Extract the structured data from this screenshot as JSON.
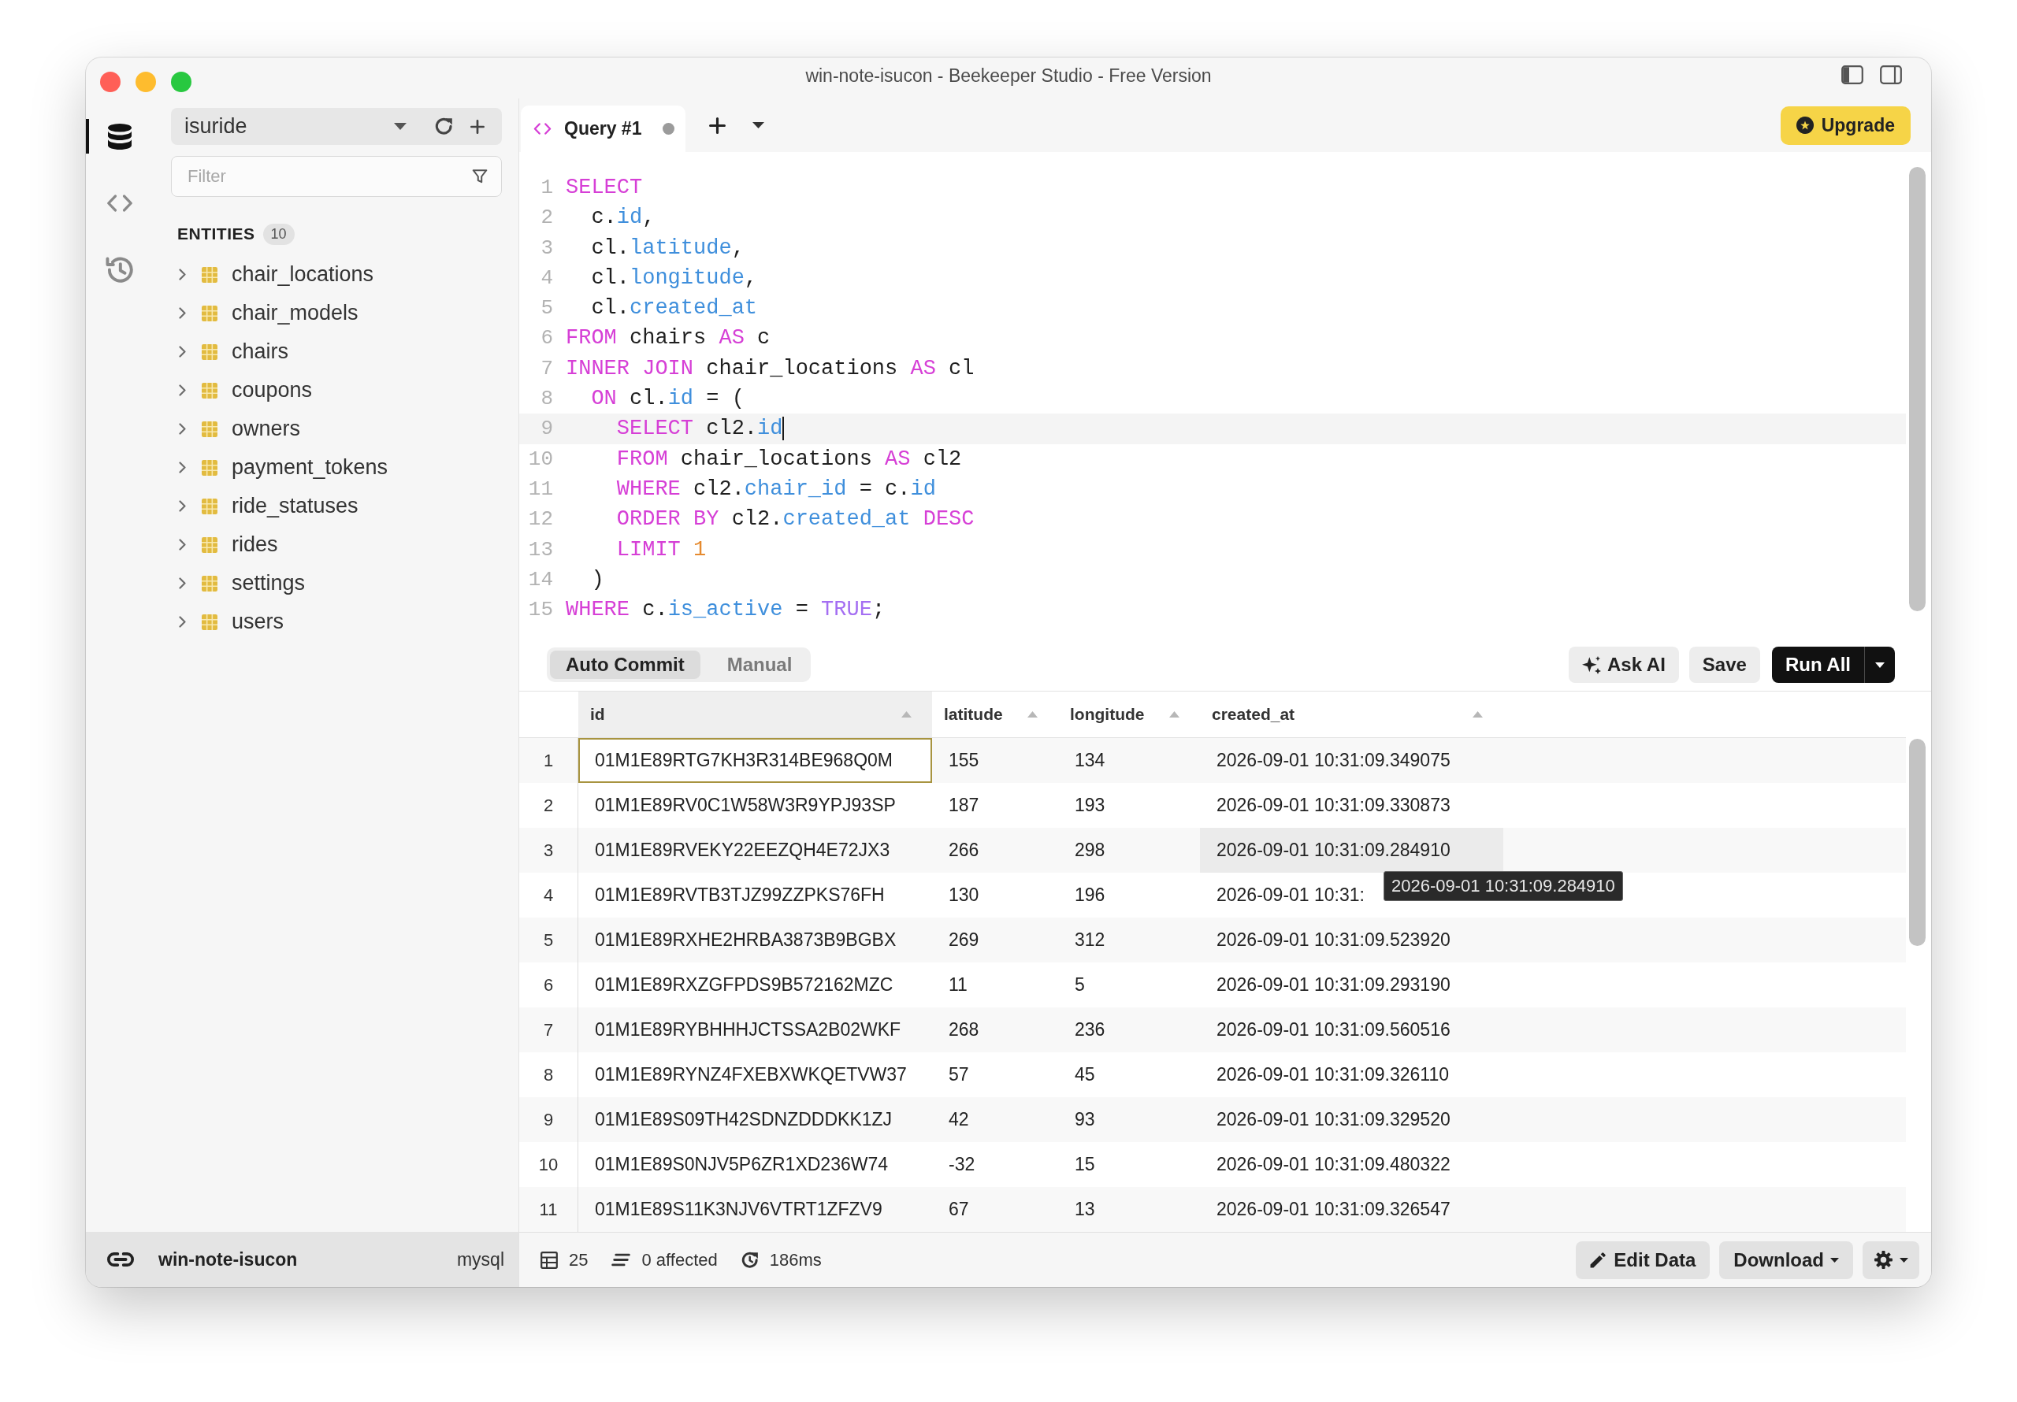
{
  "window": {
    "title": "win-note-isucon - Beekeeper Studio - Free Version"
  },
  "activity_bar": {
    "items": [
      {
        "kind": "connection",
        "selected": true
      },
      {
        "kind": "queries",
        "selected": false
      },
      {
        "kind": "history",
        "selected": false
      }
    ]
  },
  "sidebar": {
    "database": "isuride",
    "filter": {
      "placeholder": "Filter"
    },
    "entities": {
      "title": "ENTITIES",
      "count": "10",
      "items": [
        {
          "label": "chair_locations",
          "expanded": false
        },
        {
          "label": "chair_models",
          "expanded": false
        },
        {
          "label": "chairs",
          "expanded": false
        },
        {
          "label": "coupons",
          "expanded": false
        },
        {
          "label": "owners",
          "expanded": false
        },
        {
          "label": "payment_tokens",
          "expanded": false
        },
        {
          "label": "ride_statuses",
          "expanded": false
        },
        {
          "label": "rides",
          "expanded": false
        },
        {
          "label": "settings",
          "expanded": false
        },
        {
          "label": "users",
          "expanded": false
        }
      ]
    },
    "connection": {
      "name": "win-note-isucon",
      "driver": "mysql"
    }
  },
  "tabs": [
    {
      "label": "Query #1",
      "selected": true,
      "unsaved": true
    }
  ],
  "upgrade_button": {
    "label": "Upgrade"
  },
  "editor": {
    "lines": [
      {
        "number": "1",
        "active": false,
        "tokens": [
          {
            "kind": "keyword",
            "text": "SELECT"
          }
        ]
      },
      {
        "number": "2",
        "active": false,
        "tokens": [
          {
            "kind": "plain",
            "text": "  c."
          },
          {
            "kind": "field",
            "text": "id"
          },
          {
            "kind": "plain",
            "text": ","
          }
        ]
      },
      {
        "number": "3",
        "active": false,
        "tokens": [
          {
            "kind": "plain",
            "text": "  cl."
          },
          {
            "kind": "field",
            "text": "latitude"
          },
          {
            "kind": "plain",
            "text": ","
          }
        ]
      },
      {
        "number": "4",
        "active": false,
        "tokens": [
          {
            "kind": "plain",
            "text": "  cl."
          },
          {
            "kind": "field",
            "text": "longitude"
          },
          {
            "kind": "plain",
            "text": ","
          }
        ]
      },
      {
        "number": "5",
        "active": false,
        "tokens": [
          {
            "kind": "plain",
            "text": "  cl."
          },
          {
            "kind": "field",
            "text": "created_at"
          }
        ]
      },
      {
        "number": "6",
        "active": false,
        "tokens": [
          {
            "kind": "keyword",
            "text": "FROM"
          },
          {
            "kind": "plain",
            "text": " chairs "
          },
          {
            "kind": "keyword",
            "text": "AS"
          },
          {
            "kind": "plain",
            "text": " c"
          }
        ]
      },
      {
        "number": "7",
        "active": false,
        "tokens": [
          {
            "kind": "keyword",
            "text": "INNER JOIN"
          },
          {
            "kind": "plain",
            "text": " chair_locations "
          },
          {
            "kind": "keyword",
            "text": "AS"
          },
          {
            "kind": "plain",
            "text": " cl"
          }
        ]
      },
      {
        "number": "8",
        "active": false,
        "tokens": [
          {
            "kind": "keyword",
            "text": "  ON"
          },
          {
            "kind": "plain",
            "text": " cl."
          },
          {
            "kind": "field",
            "text": "id"
          },
          {
            "kind": "plain",
            "text": " = ("
          }
        ]
      },
      {
        "number": "9",
        "active": true,
        "tokens": [
          {
            "kind": "keyword",
            "text": "    SELECT"
          },
          {
            "kind": "plain",
            "text": " cl2."
          },
          {
            "kind": "field",
            "text": "id"
          }
        ]
      },
      {
        "number": "10",
        "active": false,
        "tokens": [
          {
            "kind": "keyword",
            "text": "    FROM"
          },
          {
            "kind": "plain",
            "text": " chair_locations "
          },
          {
            "kind": "keyword",
            "text": "AS"
          },
          {
            "kind": "plain",
            "text": " cl2"
          }
        ]
      },
      {
        "number": "11",
        "active": false,
        "tokens": [
          {
            "kind": "keyword",
            "text": "    WHERE"
          },
          {
            "kind": "plain",
            "text": " cl2."
          },
          {
            "kind": "field",
            "text": "chair_id"
          },
          {
            "kind": "plain",
            "text": " = c."
          },
          {
            "kind": "field",
            "text": "id"
          }
        ]
      },
      {
        "number": "12",
        "active": false,
        "tokens": [
          {
            "kind": "keyword",
            "text": "    ORDER BY"
          },
          {
            "kind": "plain",
            "text": " cl2."
          },
          {
            "kind": "field",
            "text": "created_at"
          },
          {
            "kind": "keyword",
            "text": " DESC"
          }
        ]
      },
      {
        "number": "13",
        "active": false,
        "tokens": [
          {
            "kind": "keyword",
            "text": "    LIMIT"
          },
          {
            "kind": "number",
            "text": " 1"
          }
        ]
      },
      {
        "number": "14",
        "active": false,
        "tokens": [
          {
            "kind": "plain",
            "text": "  )"
          }
        ]
      },
      {
        "number": "15",
        "active": false,
        "tokens": [
          {
            "kind": "keyword",
            "text": "WHERE"
          },
          {
            "kind": "plain",
            "text": " c."
          },
          {
            "kind": "field",
            "text": "is_active"
          },
          {
            "kind": "plain",
            "text": " = "
          },
          {
            "kind": "literal",
            "text": "TRUE"
          },
          {
            "kind": "plain",
            "text": ";"
          }
        ]
      }
    ]
  },
  "commit_mode": [
    {
      "label": "Auto Commit",
      "selected": true
    },
    {
      "label": "Manual",
      "selected": false
    }
  ],
  "actions": [
    {
      "kind": "ai",
      "label": "Ask AI"
    },
    {
      "kind": "save",
      "label": "Save"
    },
    {
      "kind": "run",
      "label": "Run All"
    }
  ],
  "results": {
    "columns": [
      {
        "label": "id",
        "selected": true
      },
      {
        "label": "latitude",
        "selected": false
      },
      {
        "label": "longitude",
        "selected": false
      },
      {
        "label": "created_at",
        "selected": false
      }
    ],
    "rows": [
      {
        "number": "1",
        "cells": [
          {
            "text": "01M1E89RTG7KH3R314BE968Q0M",
            "selected": true,
            "hovered": false
          },
          {
            "text": "155",
            "selected": false,
            "hovered": false
          },
          {
            "text": "134",
            "selected": false,
            "hovered": false
          },
          {
            "text": "2026-09-01 10:31:09.349075",
            "selected": false,
            "hovered": false
          }
        ]
      },
      {
        "number": "2",
        "cells": [
          {
            "text": "01M1E89RV0C1W58W3R9YPJ93SP",
            "selected": false,
            "hovered": false
          },
          {
            "text": "187",
            "selected": false,
            "hovered": false
          },
          {
            "text": "193",
            "selected": false,
            "hovered": false
          },
          {
            "text": "2026-09-01 10:31:09.330873",
            "selected": false,
            "hovered": false
          }
        ]
      },
      {
        "number": "3",
        "cells": [
          {
            "text": "01M1E89RVEKY22EEZQH4E72JX3",
            "selected": false,
            "hovered": false
          },
          {
            "text": "266",
            "selected": false,
            "hovered": false
          },
          {
            "text": "298",
            "selected": false,
            "hovered": false
          },
          {
            "text": "2026-09-01 10:31:09.284910",
            "selected": false,
            "hovered": true
          }
        ]
      },
      {
        "number": "4",
        "cells": [
          {
            "text": "01M1E89RVTB3TJZ99ZZPKS76FH",
            "selected": false,
            "hovered": false
          },
          {
            "text": "130",
            "selected": false,
            "hovered": false
          },
          {
            "text": "196",
            "selected": false,
            "hovered": false
          },
          {
            "text": "2026-09-01 10:31:",
            "selected": false,
            "hovered": false
          }
        ]
      },
      {
        "number": "5",
        "cells": [
          {
            "text": "01M1E89RXHE2HRBA3873B9BGBX",
            "selected": false,
            "hovered": false
          },
          {
            "text": "269",
            "selected": false,
            "hovered": false
          },
          {
            "text": "312",
            "selected": false,
            "hovered": false
          },
          {
            "text": "2026-09-01 10:31:09.523920",
            "selected": false,
            "hovered": false
          }
        ]
      },
      {
        "number": "6",
        "cells": [
          {
            "text": "01M1E89RXZGFPDS9B572162MZC",
            "selected": false,
            "hovered": false
          },
          {
            "text": "11",
            "selected": false,
            "hovered": false
          },
          {
            "text": "5",
            "selected": false,
            "hovered": false
          },
          {
            "text": "2026-09-01 10:31:09.293190",
            "selected": false,
            "hovered": false
          }
        ]
      },
      {
        "number": "7",
        "cells": [
          {
            "text": "01M1E89RYBHHHJCTSSA2B02WKF",
            "selected": false,
            "hovered": false
          },
          {
            "text": "268",
            "selected": false,
            "hovered": false
          },
          {
            "text": "236",
            "selected": false,
            "hovered": false
          },
          {
            "text": "2026-09-01 10:31:09.560516",
            "selected": false,
            "hovered": false
          }
        ]
      },
      {
        "number": "8",
        "cells": [
          {
            "text": "01M1E89RYNZ4FXEBXWKQETVW37",
            "selected": false,
            "hovered": false
          },
          {
            "text": "57",
            "selected": false,
            "hovered": false
          },
          {
            "text": "45",
            "selected": false,
            "hovered": false
          },
          {
            "text": "2026-09-01 10:31:09.326110",
            "selected": false,
            "hovered": false
          }
        ]
      },
      {
        "number": "9",
        "cells": [
          {
            "text": "01M1E89S09TH42SDNZDDDKK1ZJ",
            "selected": false,
            "hovered": false
          },
          {
            "text": "42",
            "selected": false,
            "hovered": false
          },
          {
            "text": "93",
            "selected": false,
            "hovered": false
          },
          {
            "text": "2026-09-01 10:31:09.329520",
            "selected": false,
            "hovered": false
          }
        ]
      },
      {
        "number": "10",
        "cells": [
          {
            "text": "01M1E89S0NJV5P6ZR1XD236W74",
            "selected": false,
            "hovered": false
          },
          {
            "text": "-32",
            "selected": false,
            "hovered": false
          },
          {
            "text": "15",
            "selected": false,
            "hovered": false
          },
          {
            "text": "2026-09-01 10:31:09.480322",
            "selected": false,
            "hovered": false
          }
        ]
      },
      {
        "number": "11",
        "cells": [
          {
            "text": "01M1E89S11K3NJV6VTRT1ZFZV9",
            "selected": false,
            "hovered": false
          },
          {
            "text": "67",
            "selected": false,
            "hovered": false
          },
          {
            "text": "13",
            "selected": false,
            "hovered": false
          },
          {
            "text": "2026-09-01 10:31:09.326547",
            "selected": false,
            "hovered": false
          }
        ]
      }
    ],
    "tooltip": "2026-09-01 10:31:09.284910"
  },
  "status_bar": {
    "stats": [
      {
        "kind": "rows",
        "text": "25"
      },
      {
        "kind": "affected",
        "text": "0 affected"
      },
      {
        "kind": "duration",
        "text": "186ms"
      }
    ],
    "buttons": [
      {
        "kind": "edit",
        "label": "Edit Data"
      },
      {
        "kind": "download",
        "label": "Download"
      },
      {
        "kind": "settings"
      }
    ]
  }
}
